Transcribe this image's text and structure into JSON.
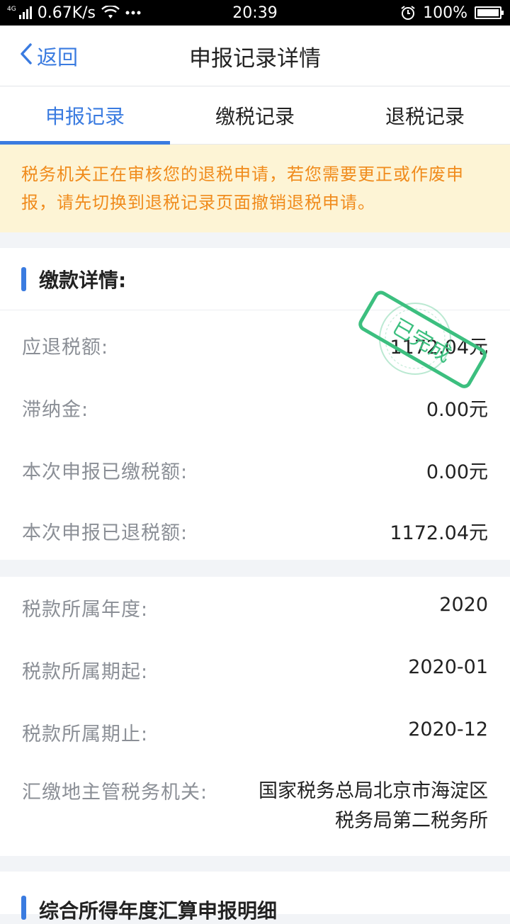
{
  "status_bar": {
    "network": "4G",
    "speed": "0.67K/s",
    "time": "20:39",
    "battery": "100%",
    "battery_level": 1.0
  },
  "header": {
    "back_label": "返回",
    "title": "申报记录详情"
  },
  "tabs": [
    {
      "label": "申报记录",
      "active": true
    },
    {
      "label": "缴税记录",
      "active": false
    },
    {
      "label": "退税记录",
      "active": false
    }
  ],
  "notice": {
    "text": "税务机关正在审核您的退税申请，若您需要更正或作废申报，请先切换到退税记录页面撤销退税申请。"
  },
  "payment": {
    "title": "缴款详情:",
    "rows": [
      {
        "label": "应退税额:",
        "value": "1172.04元"
      },
      {
        "label": "滞纳金:",
        "value": "0.00元"
      },
      {
        "label": "本次申报已缴税额:",
        "value": "0.00元"
      },
      {
        "label": "本次申报已退税额:",
        "value": "1172.04元"
      }
    ],
    "stamp": "已完成"
  },
  "period": {
    "rows": [
      {
        "label": "税款所属年度:",
        "value": "2020"
      },
      {
        "label": "税款所属期起:",
        "value": "2020-01"
      },
      {
        "label": "税款所属期止:",
        "value": "2020-12"
      },
      {
        "label": "汇缴地主管税务机关:",
        "value": "国家税务总局北京市海淀区税务局第二税务所"
      }
    ]
  },
  "detail": {
    "title": "综合所得年度汇算申报明细"
  },
  "colors": {
    "accent": "#3a7be0",
    "notice_text": "#f08b1c",
    "notice_bg": "#fdf4d5",
    "stamp": "#3cbf7f"
  }
}
